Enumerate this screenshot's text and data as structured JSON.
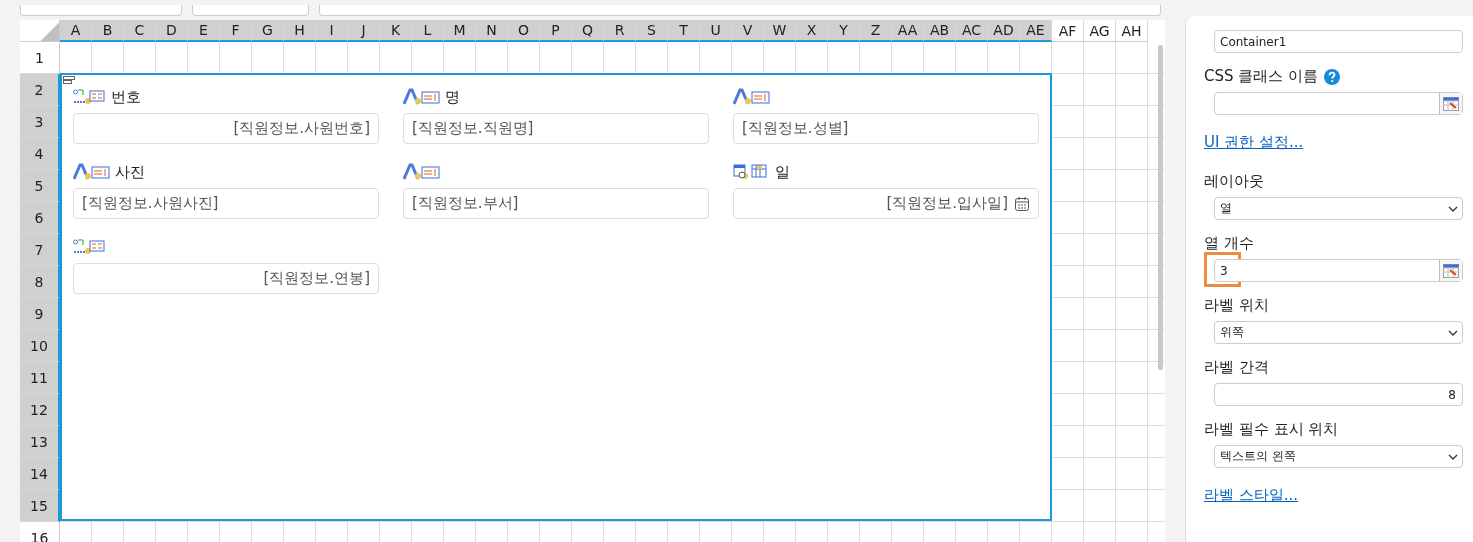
{
  "columns": [
    {
      "label": "A",
      "selected": true
    },
    {
      "label": "B",
      "selected": true
    },
    {
      "label": "C",
      "selected": true
    },
    {
      "label": "D",
      "selected": true
    },
    {
      "label": "E",
      "selected": true
    },
    {
      "label": "F",
      "selected": true
    },
    {
      "label": "G",
      "selected": true
    },
    {
      "label": "H",
      "selected": true
    },
    {
      "label": "I",
      "selected": true
    },
    {
      "label": "J",
      "selected": true
    },
    {
      "label": "K",
      "selected": true
    },
    {
      "label": "L",
      "selected": true
    },
    {
      "label": "M",
      "selected": true
    },
    {
      "label": "N",
      "selected": true
    },
    {
      "label": "O",
      "selected": true
    },
    {
      "label": "P",
      "selected": true
    },
    {
      "label": "Q",
      "selected": true
    },
    {
      "label": "R",
      "selected": true
    },
    {
      "label": "S",
      "selected": true
    },
    {
      "label": "T",
      "selected": true
    },
    {
      "label": "U",
      "selected": true
    },
    {
      "label": "V",
      "selected": true
    },
    {
      "label": "W",
      "selected": true
    },
    {
      "label": "X",
      "selected": true
    },
    {
      "label": "Y",
      "selected": true
    },
    {
      "label": "Z",
      "selected": true
    },
    {
      "label": "AA",
      "selected": true
    },
    {
      "label": "AB",
      "selected": true
    },
    {
      "label": "AC",
      "selected": true
    },
    {
      "label": "AD",
      "selected": true
    },
    {
      "label": "AE",
      "selected": true
    },
    {
      "label": "AF",
      "selected": false
    },
    {
      "label": "AG",
      "selected": false
    },
    {
      "label": "AH",
      "selected": false
    }
  ],
  "rows": [
    {
      "label": "1",
      "selected": false
    },
    {
      "label": "2",
      "selected": true
    },
    {
      "label": "3",
      "selected": true
    },
    {
      "label": "4",
      "selected": true
    },
    {
      "label": "5",
      "selected": true
    },
    {
      "label": "6",
      "selected": true
    },
    {
      "label": "7",
      "selected": true
    },
    {
      "label": "8",
      "selected": true
    },
    {
      "label": "9",
      "selected": true
    },
    {
      "label": "10",
      "selected": true
    },
    {
      "label": "11",
      "selected": true
    },
    {
      "label": "12",
      "selected": true
    },
    {
      "label": "13",
      "selected": true
    },
    {
      "label": "14",
      "selected": true
    },
    {
      "label": "15",
      "selected": true
    },
    {
      "label": "16",
      "selected": false
    }
  ],
  "container": {
    "fields": [
      {
        "kind": "number",
        "label": "번호",
        "value": "[직원정보.사원번호]"
      },
      {
        "kind": "text",
        "label": "명",
        "value": "[직원정보.직원명]"
      },
      {
        "kind": "text",
        "value": "[직원정보.성별]"
      },
      {
        "kind": "text",
        "label": "사진",
        "value": "[직원정보.사원사진]"
      },
      {
        "kind": "text",
        "value": "[직원정보.부서]"
      },
      {
        "kind": "date",
        "label": "일",
        "value": "[직원정보.입사일]"
      },
      {
        "kind": "number",
        "value": "[직원정보.연봉]"
      }
    ]
  },
  "properties": [
    {
      "kind": "input",
      "value": "Container1",
      "picker": false,
      "highlighted": false
    },
    {
      "kind": "help-label",
      "text": "CSS 클래스 이름"
    },
    {
      "kind": "input",
      "picker": true,
      "highlighted": false
    },
    {
      "kind": "link",
      "text": "UI 권한 설정..."
    },
    {
      "kind": "label",
      "text": "레이아웃"
    },
    {
      "kind": "select",
      "value": "열"
    },
    {
      "kind": "label",
      "text": "열 개수"
    },
    {
      "kind": "input",
      "value": "3",
      "picker": true,
      "highlighted": true
    },
    {
      "kind": "label",
      "text": "라벨 위치"
    },
    {
      "kind": "select",
      "value": "위쪽"
    },
    {
      "kind": "label",
      "text": "라벨 간격"
    },
    {
      "kind": "number",
      "value": "8"
    },
    {
      "kind": "label",
      "text": "라벨 필수 표시 위치"
    },
    {
      "kind": "select",
      "value": "텍스트의 왼쪽"
    },
    {
      "kind": "link",
      "text": "라벨 스타일..."
    }
  ]
}
